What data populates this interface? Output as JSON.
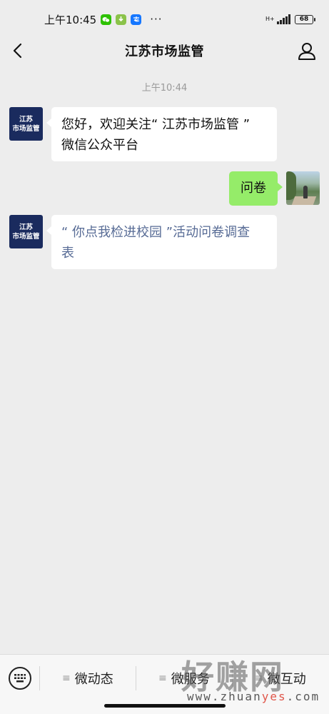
{
  "status_bar": {
    "time": "上午10:45",
    "badges": [
      "wechat-icon",
      "download-icon",
      "alipay-icon"
    ],
    "dots": "···",
    "network": "H+",
    "battery": "68"
  },
  "nav": {
    "title": "江苏市场监管",
    "back_icon": "chevron-left-icon",
    "profile_icon": "person-icon"
  },
  "chat": {
    "timestamp": "上午10:44",
    "messages": [
      {
        "sender": "official",
        "avatar_text": [
          "江苏",
          "市场监管"
        ],
        "lines": [
          "您好，欢迎关注“ 江苏市场监管 ”",
          "微信公众平台"
        ]
      },
      {
        "sender": "user",
        "text": "问卷"
      },
      {
        "sender": "official",
        "avatar_text": [
          "江苏",
          "市场监管"
        ],
        "lines": [
          "“ 你点我检进校园 ”活动问卷调查",
          "表"
        ]
      }
    ]
  },
  "bottom_menu": {
    "keyboard_icon": "keyboard-icon",
    "items": [
      {
        "label": "微动态"
      },
      {
        "label": "微服务"
      },
      {
        "label": "微互动"
      }
    ]
  },
  "watermark": {
    "text": "好赚网",
    "url_prefix": "www.zhuan",
    "url_highlight": "yes",
    "url_suffix": ".com"
  },
  "colors": {
    "background": "#ededed",
    "bubble_self": "#95ec69",
    "bubble_other": "#ffffff",
    "link": "#576b95",
    "org_avatar": "#1a2b5e"
  }
}
